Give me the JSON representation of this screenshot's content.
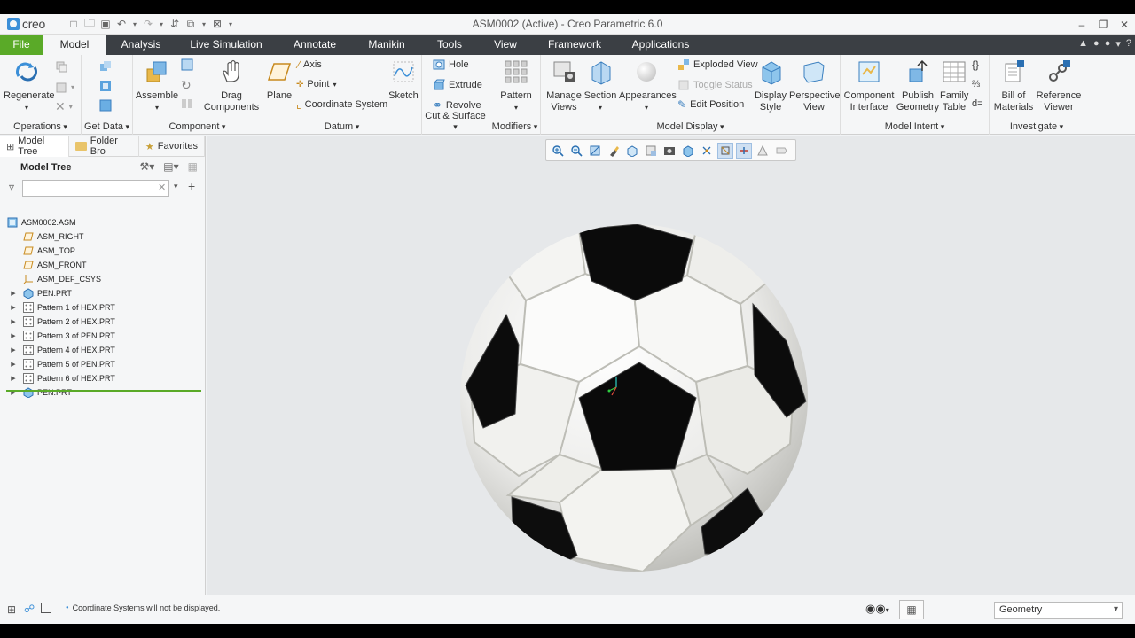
{
  "app": {
    "logo_text": "creo",
    "window_title": "ASM0002 (Active) - Creo Parametric 6.0"
  },
  "colors": {
    "file_tab": "#5aaa28",
    "tabbar": "#3b3f44",
    "accent_blue": "#3b8fd8"
  },
  "ribbon_tabs": [
    {
      "label": "File"
    },
    {
      "label": "Model",
      "active": true
    },
    {
      "label": "Analysis"
    },
    {
      "label": "Live Simulation"
    },
    {
      "label": "Annotate"
    },
    {
      "label": "Manikin"
    },
    {
      "label": "Tools"
    },
    {
      "label": "View"
    },
    {
      "label": "Framework"
    },
    {
      "label": "Applications"
    }
  ],
  "ribbon": {
    "operations": {
      "label": "Operations",
      "regenerate": "Regenerate"
    },
    "get_data": {
      "label": "Get Data"
    },
    "component": {
      "label": "Component",
      "assemble": "Assemble",
      "drag": "Drag Components"
    },
    "datum": {
      "label": "Datum",
      "plane": "Plane",
      "axis": "Axis",
      "point": "Point",
      "csys": "Coordinate System",
      "sketch": "Sketch"
    },
    "cut_surface": {
      "label": "Cut & Surface",
      "hole": "Hole",
      "extrude": "Extrude",
      "revolve": "Revolve"
    },
    "modifiers": {
      "label": "Modifiers",
      "pattern": "Pattern"
    },
    "model_display": {
      "label": "Model Display",
      "manage_views": "Manage Views",
      "section": "Section",
      "appearances": "Appearances",
      "exploded_view": "Exploded View",
      "toggle_status": "Toggle Status",
      "edit_position": "Edit Position",
      "display_style": "Display Style",
      "perspective_view": "Perspective View"
    },
    "model_intent": {
      "label": "Model Intent",
      "component_interface": "Component Interface",
      "publish_geometry": "Publish Geometry",
      "family_table": "Family Table"
    },
    "investigate": {
      "label": "Investigate",
      "bom": "Bill of Materials",
      "reference_viewer": "Reference Viewer"
    }
  },
  "panel_tabs": [
    {
      "label": "Model Tree",
      "icon": "tree-icon"
    },
    {
      "label": "Folder Bro",
      "icon": "folder-icon"
    },
    {
      "label": "Favorites",
      "icon": "star-icon"
    }
  ],
  "model_tree": {
    "title": "Model Tree",
    "search_placeholder": "",
    "items": [
      {
        "label": "ASM0002.ASM",
        "icon": "assembly-icon",
        "expandable": false,
        "level": 0
      },
      {
        "label": "ASM_RIGHT",
        "icon": "datum-plane-icon",
        "expandable": false,
        "level": 1
      },
      {
        "label": "ASM_TOP",
        "icon": "datum-plane-icon",
        "expandable": false,
        "level": 1
      },
      {
        "label": "ASM_FRONT",
        "icon": "datum-plane-icon",
        "expandable": false,
        "level": 1
      },
      {
        "label": "ASM_DEF_CSYS",
        "icon": "csys-icon",
        "expandable": false,
        "level": 1
      },
      {
        "label": "PEN.PRT",
        "icon": "part-icon",
        "expandable": true,
        "level": 1
      },
      {
        "label": "Pattern 1 of HEX.PRT",
        "icon": "pattern-icon",
        "expandable": true,
        "level": 1
      },
      {
        "label": "Pattern 2 of HEX.PRT",
        "icon": "pattern-icon",
        "expandable": true,
        "level": 1
      },
      {
        "label": "Pattern 3 of PEN.PRT",
        "icon": "pattern-icon",
        "expandable": true,
        "level": 1
      },
      {
        "label": "Pattern 4 of HEX.PRT",
        "icon": "pattern-icon",
        "expandable": true,
        "level": 1
      },
      {
        "label": "Pattern 5 of PEN.PRT",
        "icon": "pattern-icon",
        "expandable": true,
        "level": 1
      },
      {
        "label": "Pattern 6 of HEX.PRT",
        "icon": "pattern-icon",
        "expandable": true,
        "level": 1
      },
      {
        "label": "PEN.PRT",
        "icon": "part-icon",
        "expandable": true,
        "level": 1
      }
    ]
  },
  "status": {
    "message": "Coordinate Systems will not be displayed.",
    "filter_value": "Geometry"
  }
}
